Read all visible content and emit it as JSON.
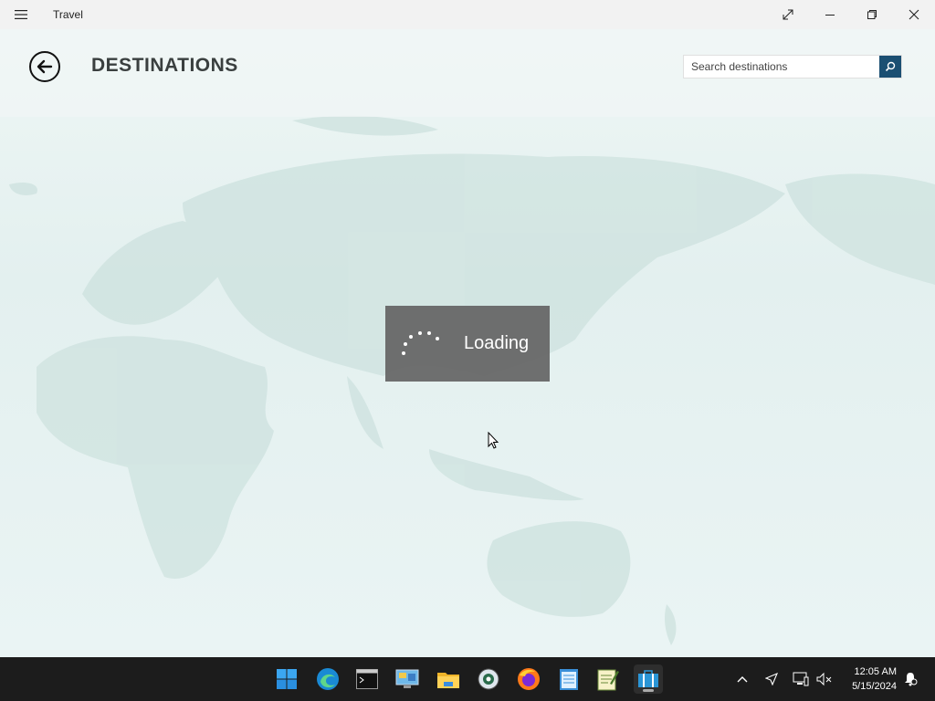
{
  "window": {
    "title": "Travel"
  },
  "header": {
    "title": "DESTINATIONS"
  },
  "search": {
    "placeholder": "Search destinations",
    "value": ""
  },
  "loading": {
    "text": "Loading"
  },
  "taskbar": {
    "apps": [
      {
        "name": "start-icon"
      },
      {
        "name": "edge-icon"
      },
      {
        "name": "terminal-icon"
      },
      {
        "name": "control-panel-icon"
      },
      {
        "name": "file-explorer-icon"
      },
      {
        "name": "media-player-icon"
      },
      {
        "name": "firefox-icon"
      },
      {
        "name": "notepad-icon"
      },
      {
        "name": "editor-icon"
      },
      {
        "name": "travel-app-icon"
      }
    ],
    "time": "12:05 AM",
    "date": "5/15/2024"
  },
  "colors": {
    "accent": "#1b4f72",
    "taskbar": "#1c1c1c",
    "overlay": "#646464"
  }
}
